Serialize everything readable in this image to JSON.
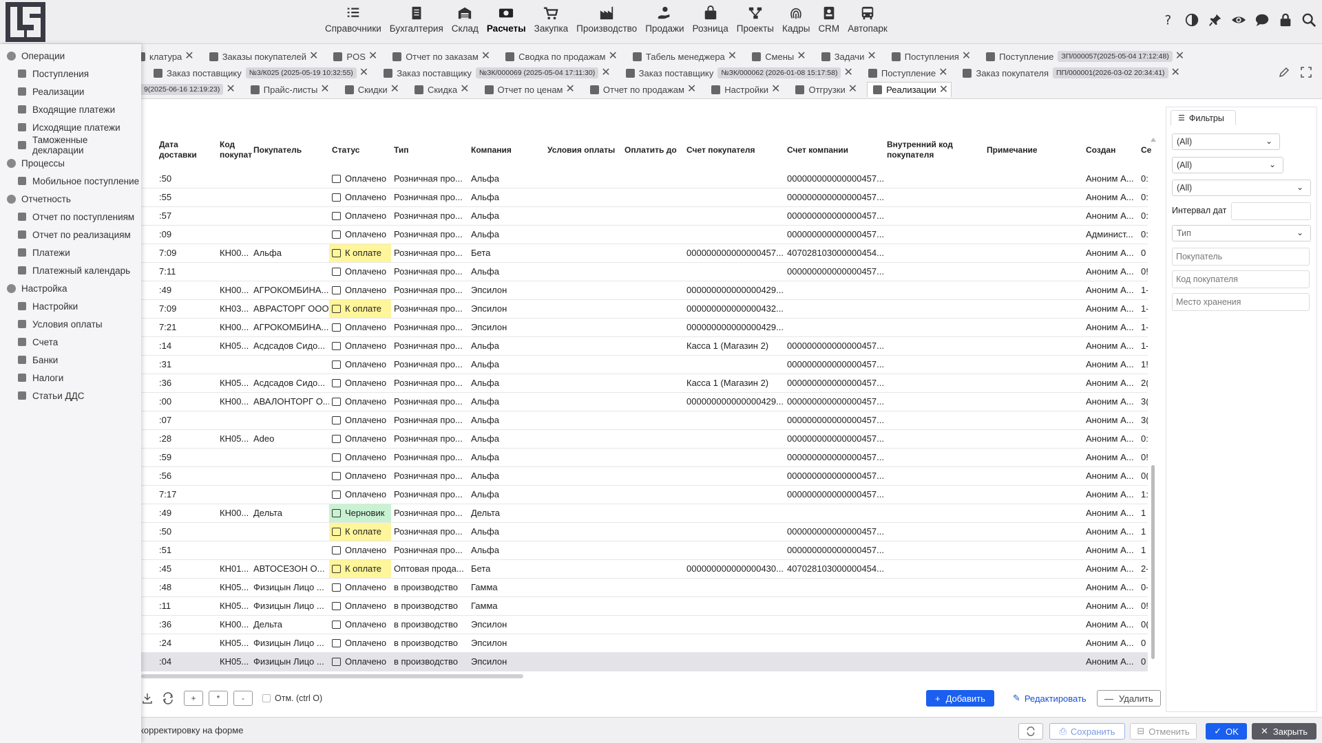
{
  "top": {
    "modules": [
      {
        "label": "Справочники",
        "icon": "list-check-icon"
      },
      {
        "label": "Бухгалтерия",
        "icon": "ledger-icon"
      },
      {
        "label": "Склад",
        "icon": "warehouse-icon"
      },
      {
        "label": "Расчеты",
        "icon": "money-icon",
        "active": true
      },
      {
        "label": "Закупка",
        "icon": "cart-icon"
      },
      {
        "label": "Производство",
        "icon": "factory-icon"
      },
      {
        "label": "Продажи",
        "icon": "hand-coin-icon"
      },
      {
        "label": "Розница",
        "icon": "bag-icon"
      },
      {
        "label": "Проекты",
        "icon": "hierarchy-icon"
      },
      {
        "label": "Кадры",
        "icon": "fingerprint-icon"
      },
      {
        "label": "CRM",
        "icon": "id-card-icon"
      },
      {
        "label": "Автопарк",
        "icon": "bus-icon"
      }
    ],
    "right_icons": [
      "help-icon",
      "contrast-icon",
      "pin-icon",
      "eye-icon",
      "chat-icon",
      "lock-icon",
      "search-icon"
    ]
  },
  "tabs": {
    "row1": [
      {
        "label": "клатура"
      },
      {
        "label": "Заказы покупателей"
      },
      {
        "label": "POS"
      },
      {
        "label": "Отчет по заказам"
      },
      {
        "label": "Сводка по продажам"
      },
      {
        "label": "Табель менеджера"
      },
      {
        "label": "Смены"
      },
      {
        "label": "Задачи"
      },
      {
        "label": "Поступления"
      },
      {
        "label": "Поступление",
        "badge": "ЗП/000057(2025-05-04 17:12:48)"
      }
    ],
    "row2": [
      {
        "label": "Заказ поставщику",
        "badge": "№3/К025 (2025-05-19 10:32:55)"
      },
      {
        "label": "Заказ поставщику",
        "badge": "№ЗК/000069 (2025-05-04 17:11:30)"
      },
      {
        "label": "Заказ поставщику",
        "badge": "№ЗК/000062 (2026-01-08 15:17:58)"
      },
      {
        "label": "Поступление"
      },
      {
        "label": "Заказ покупателя",
        "badge": "ПП/000001(2026-03-02 20:34:41)"
      }
    ],
    "row3": [
      {
        "label": "9(2025-06-16 12:19:23)",
        "is_badge": true
      },
      {
        "label": "Прайс-листы"
      },
      {
        "label": "Скидки"
      },
      {
        "label": "Скидка"
      },
      {
        "label": "Отчет по ценам"
      },
      {
        "label": "Отчет по продажам"
      },
      {
        "label": "Настройки"
      },
      {
        "label": "Отгрузки"
      },
      {
        "label": "Реализации",
        "active": true
      }
    ]
  },
  "sidebar": {
    "groups": [
      {
        "label": "Операции",
        "items": [
          "Поступления",
          "Реализации",
          "Входящие платежи",
          "Исходящие платежи",
          "Таможенные декларации"
        ]
      },
      {
        "label": "Процессы",
        "items": [
          "Мобильное поступление"
        ]
      },
      {
        "label": "Отчетность",
        "items": [
          "Отчет по поступлениям",
          "Отчет по реализациям",
          "Платежи",
          "Платежный календарь"
        ]
      },
      {
        "label": "Настройка",
        "items": [
          "Настройки",
          "Условия оплаты",
          "Счета",
          "Банки",
          "Налоги",
          "Статьи ДДС"
        ]
      }
    ]
  },
  "grid": {
    "columns": [
      "Дата доставки",
      "Код покупат",
      "Покупатель",
      "Статус",
      "Тип",
      "Компания",
      "Условия оплаты",
      "Оплатить до",
      "Счет покупателя",
      "Счет компании",
      "Внутренний код покупателя",
      "Примечание",
      "Создан",
      "Ce"
    ],
    "rows": [
      [
        ":50",
        "",
        "",
        "Оплачено",
        "Розничная про...",
        "Альфа",
        "",
        "",
        "",
        "000000000000000457...",
        "",
        "",
        "Аноним А...",
        "0:"
      ],
      [
        ":55",
        "",
        "",
        "Оплачено",
        "Розничная про...",
        "Альфа",
        "",
        "",
        "",
        "000000000000000457...",
        "",
        "",
        "Аноним А...",
        "0:"
      ],
      [
        ":57",
        "",
        "",
        "Оплачено",
        "Розничная про...",
        "Альфа",
        "",
        "",
        "",
        "000000000000000457...",
        "",
        "",
        "Аноним А...",
        "0:"
      ],
      [
        ":09",
        "",
        "",
        "Оплачено",
        "Розничная про...",
        "Альфа",
        "",
        "",
        "",
        "000000000000000457...",
        "",
        "",
        "Админист...",
        "0:"
      ],
      [
        "7:09",
        "КН00...",
        "Альфа",
        "К оплате",
        "Розничная про...",
        "Бета",
        "",
        "",
        "000000000000000457...",
        "407028103000000454...",
        "",
        "",
        "Аноним А...",
        "0"
      ],
      [
        "7:11",
        "",
        "",
        "Оплачено",
        "Розничная про...",
        "Альфа",
        "",
        "",
        "",
        "000000000000000457...",
        "",
        "",
        "Аноним А...",
        "0!"
      ],
      [
        ":49",
        "КН00...",
        "АГРОКОМБИНА...",
        "Оплачено",
        "Розничная про...",
        "Эпсилон",
        "",
        "",
        "000000000000000429...",
        "",
        "",
        "",
        "Аноним А...",
        "1-"
      ],
      [
        "7:09",
        "КН03...",
        "АВРАСТОРГ ООО",
        "К оплате",
        "Розничная про...",
        "Эпсилон",
        "",
        "",
        "000000000000000432...",
        "",
        "",
        "",
        "Аноним А...",
        "1-"
      ],
      [
        "7:21",
        "КН00...",
        "АГРОКОМБИНА...",
        "Оплачено",
        "Розничная про...",
        "Эпсилон",
        "",
        "",
        "000000000000000429...",
        "",
        "",
        "",
        "Аноним А...",
        "1-"
      ],
      [
        ":14",
        "КН05...",
        "Асдсадов Сидо...",
        "Оплачено",
        "Розничная про...",
        "Альфа",
        "",
        "",
        "Касса 1 (Магазин 2)",
        "000000000000000457...",
        "",
        "",
        "Аноним А...",
        "1-"
      ],
      [
        ":31",
        "",
        "",
        "Оплачено",
        "Розничная про...",
        "Альфа",
        "",
        "",
        "",
        "000000000000000457...",
        "",
        "",
        "Аноним А...",
        "1!"
      ],
      [
        ":36",
        "КН05...",
        "Асдсадов Сидо...",
        "Оплачено",
        "Розничная про...",
        "Альфа",
        "",
        "",
        "Касса 1 (Магазин 2)",
        "000000000000000457...",
        "",
        "",
        "Аноним А...",
        "2("
      ],
      [
        ":00",
        "КН00...",
        "АВАЛОНТОРГ О...",
        "Оплачено",
        "Розничная про...",
        "Альфа",
        "",
        "",
        "000000000000000429...",
        "000000000000000457...",
        "",
        "",
        "Аноним А...",
        "3("
      ],
      [
        ":07",
        "",
        "",
        "Оплачено",
        "Розничная про...",
        "Альфа",
        "",
        "",
        "",
        "000000000000000457...",
        "",
        "",
        "Аноним А...",
        "3("
      ],
      [
        ":28",
        "КН05...",
        "Adeo",
        "Оплачено",
        "Розничная про...",
        "Альфа",
        "",
        "",
        "",
        "000000000000000457...",
        "",
        "",
        "Аноним А...",
        "0:"
      ],
      [
        ":59",
        "",
        "",
        "Оплачено",
        "Розничная про...",
        "Альфа",
        "",
        "",
        "",
        "000000000000000457...",
        "",
        "",
        "Аноним А...",
        "0!"
      ],
      [
        ":56",
        "",
        "",
        "Оплачено",
        "Розничная про...",
        "Альфа",
        "",
        "",
        "",
        "000000000000000457...",
        "",
        "",
        "Аноним А...",
        "0("
      ],
      [
        "7:17",
        "",
        "",
        "Оплачено",
        "Розничная про...",
        "Альфа",
        "",
        "",
        "",
        "000000000000000457...",
        "",
        "",
        "Аноним А...",
        "1:"
      ],
      [
        ":49",
        "КН00...",
        "Дельта",
        "Черновик",
        "Розничная про...",
        "Дельта",
        "",
        "",
        "",
        "",
        "",
        "",
        "Аноним А...",
        "1"
      ],
      [
        ":50",
        "",
        "",
        "К оплате",
        "Розничная про...",
        "Альфа",
        "",
        "",
        "",
        "000000000000000457...",
        "",
        "",
        "Аноним А...",
        "1"
      ],
      [
        ":51",
        "",
        "",
        "Оплачено",
        "Розничная про...",
        "Альфа",
        "",
        "",
        "",
        "000000000000000457...",
        "",
        "",
        "Аноним А...",
        "1"
      ],
      [
        ":45",
        "КН01...",
        "АВТОСЕЗОН О...",
        "К оплате",
        "Оптовая прода...",
        "Бета",
        "",
        "",
        "000000000000000430...",
        "407028103000000454...",
        "",
        "",
        "Аноним А...",
        "2-"
      ],
      [
        ":48",
        "КН05...",
        "Физицын Лицо ...",
        "Оплачено",
        "в производство",
        "Гамма",
        "",
        "",
        "",
        "",
        "",
        "",
        "Аноним А...",
        "0-"
      ],
      [
        ":11",
        "КН05...",
        "Физицын Лицо ...",
        "Оплачено",
        "в производство",
        "Гамма",
        "",
        "",
        "",
        "",
        "",
        "",
        "Аноним А...",
        "0!"
      ],
      [
        ":36",
        "КН00...",
        "Дельта",
        "Оплачено",
        "в производство",
        "Эпсилон",
        "",
        "",
        "",
        "",
        "",
        "",
        "Аноним А...",
        "0("
      ],
      [
        ":24",
        "КН05...",
        "Физицын Лицо ...",
        "Оплачено",
        "в производство",
        "Эпсилон",
        "",
        "",
        "",
        "",
        "",
        "",
        "Аноним А...",
        "0"
      ],
      [
        ":04",
        "КН05...",
        "Физицын Лицо ...",
        "Оплачено",
        "в производство",
        "Эпсилон",
        "",
        "",
        "",
        "",
        "",
        "",
        "Аноним А...",
        "0"
      ]
    ]
  },
  "toolbar": {
    "plus": "+",
    "star": "*",
    "minus": "-",
    "mark": "Отм. (ctrl O)",
    "add": "Добавить",
    "edit": "Редактировать",
    "delete": "Удалить"
  },
  "filters": {
    "tab": "Фильтры",
    "sel1": "(All)",
    "sel2": "(All)",
    "sel3": "(All)",
    "date_label": "Интервал дат",
    "type": "Тип",
    "buyer": "Покупатель",
    "buyer_code": "Код покупателя",
    "storage": "Место хранения"
  },
  "footer": {
    "text": "корректировку на форме",
    "save": "Сохранить",
    "cancel": "Отменить",
    "ok": "OK",
    "close": "Закрыть"
  },
  "colors": {
    "accent": "#1a5ff0",
    "status_yellow": "#fff59a",
    "status_green": "#c9f2d2",
    "dark": "#3a3a44"
  }
}
